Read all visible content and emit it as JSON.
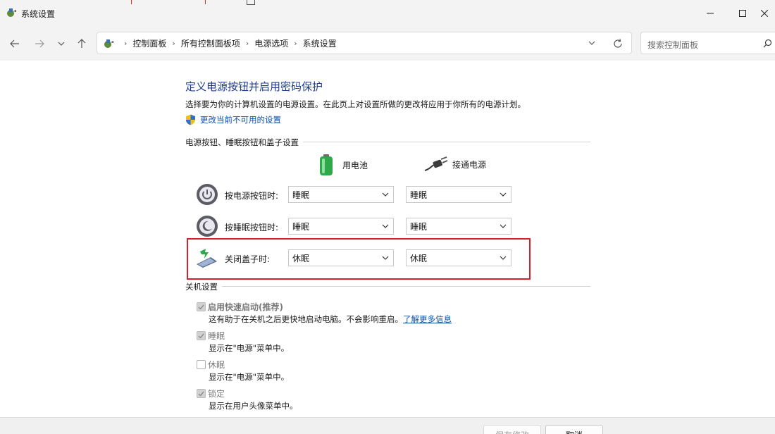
{
  "window": {
    "title": "系统设置"
  },
  "nav": {
    "breadcrumbs": [
      "控制面板",
      "所有控制面板项",
      "电源选项",
      "系统设置"
    ],
    "search_placeholder": "搜索控制面板"
  },
  "page": {
    "heading": "定义电源按钮并启用密码保护",
    "description": "选择要为你的计算机设置的电源设置。在此页上对设置所做的更改将应用于你所有的电源计划。",
    "change_link": "更改当前不可用的设置"
  },
  "buttons_section": {
    "title": "电源按钮、睡眠按钮和盖子设置",
    "col_battery": "用电池",
    "col_plugged": "接通电源",
    "rows": [
      {
        "label": "按电源按钮时:",
        "battery": "睡眠",
        "plugged": "睡眠"
      },
      {
        "label": "按睡眠按钮时:",
        "battery": "睡眠",
        "plugged": "睡眠"
      },
      {
        "label": "关闭盖子时:",
        "battery": "休眠",
        "plugged": "休眠"
      }
    ]
  },
  "shutdown_section": {
    "title": "关机设置",
    "items": [
      {
        "label": "启用快速启动(推荐)",
        "checked": true,
        "desc": "这有助于在关机之后更快地启动电脑。不会影响重启。",
        "link": "了解更多信息"
      },
      {
        "label": "睡眠",
        "checked": true,
        "desc": "显示在\"电源\"菜单中。"
      },
      {
        "label": "休眠",
        "checked": false,
        "desc": "显示在\"电源\"菜单中。"
      },
      {
        "label": "锁定",
        "checked": true,
        "desc": "显示在用户头像菜单中。"
      }
    ]
  },
  "footer": {
    "save_label": "保存修改",
    "cancel_label": "取消"
  },
  "colors": {
    "heading": "#1e3c8c",
    "link": "#0b4fa8",
    "highlight_border": "#d4222c"
  }
}
